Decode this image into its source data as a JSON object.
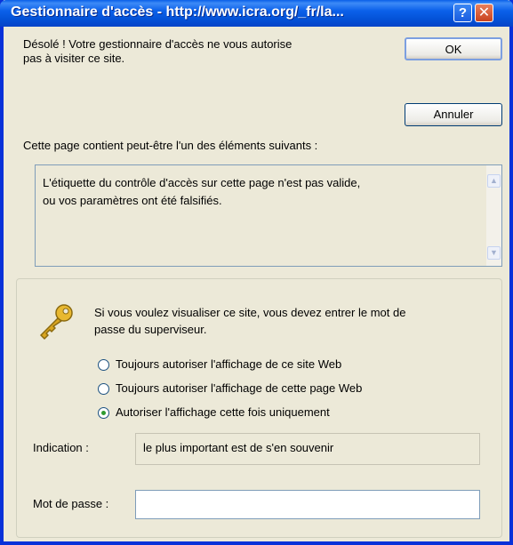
{
  "window": {
    "title": "Gestionnaire d'accès - http://www.icra.org/_fr/la...",
    "help_label": "?",
    "close_label": "✕"
  },
  "message": {
    "line1": "Désolé ! Votre gestionnaire d'accès ne vous autorise",
    "line2": "pas à visiter ce site."
  },
  "buttons": {
    "ok": "OK",
    "cancel": "Annuler"
  },
  "reasons_label": "Cette page contient peut-être l'un des éléments suivants :",
  "reasons_box": {
    "line1": "L'étiquette du contrôle d'accès sur cette page n'est pas valide,",
    "line2": "ou vos paramètres ont été falsifiés."
  },
  "supervisor": {
    "icon": "key-icon",
    "line1": "Si vous voulez visualiser ce site, vous devez entrer le mot de",
    "line2": "passe du superviseur."
  },
  "options": [
    {
      "label": "Toujours autoriser l'affichage de ce site Web",
      "selected": false
    },
    {
      "label": "Toujours autoriser l'affichage de cette page Web",
      "selected": false
    },
    {
      "label": "Autoriser l'affichage cette fois uniquement",
      "selected": true
    }
  ],
  "hint": {
    "label": "Indication :",
    "value": "le plus important est de s'en souvenir"
  },
  "password": {
    "label": "Mot de passe :",
    "value": ""
  }
}
